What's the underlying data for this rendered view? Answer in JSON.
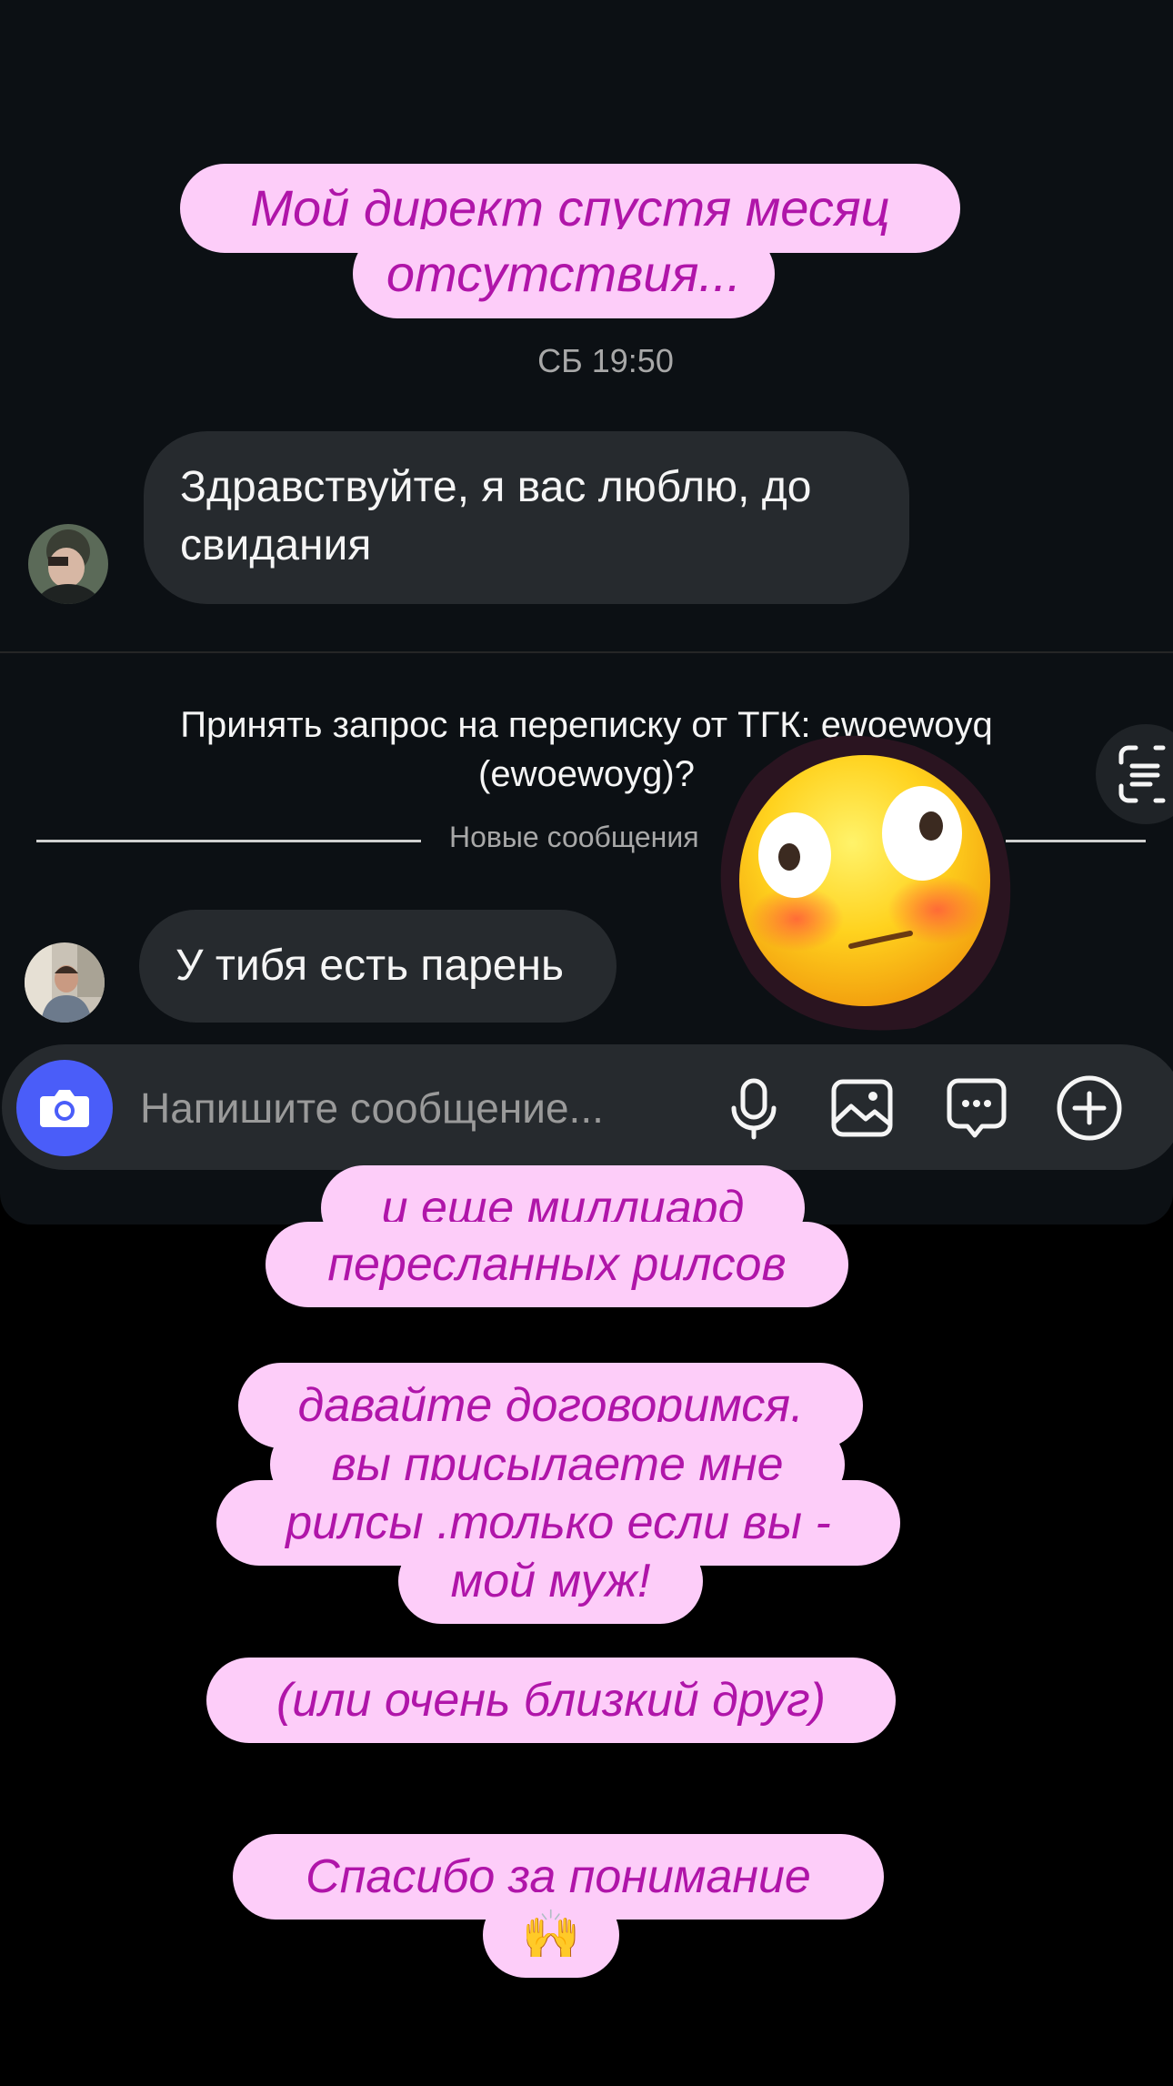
{
  "captions": {
    "top_line1": "Мой директ спустя месяц",
    "top_line2": "отсутствия...",
    "reels_line1": "и еще миллиард",
    "reels_line2": "пересланных рилсов",
    "deal_line1": "давайте договоримся,",
    "deal_line2": "вы присылаете мне",
    "deal_line3": "рилсы ,только если вы -",
    "deal_line4": "мой муж!",
    "friend": "(или очень близкий друг)",
    "thanks_line1": "Спасибо за понимание",
    "thanks_emoji": "🙌"
  },
  "thread": {
    "timestamp": "СБ 19:50",
    "message1": "Здравствуйте, я вас люблю, до свидания",
    "request_text": "Принять запрос на переписку от ТГК: ewoewoyq (ewoewoyg)?",
    "new_messages_label": "Новые сообщения",
    "message2": "У тибя есть парень"
  },
  "composer": {
    "placeholder": "Напишите сообщение..."
  },
  "colors": {
    "caption_bg": "#fdcdf9",
    "caption_text": "#b015a9",
    "bubble_bg": "#262a2e",
    "camera_button": "#4a5df9"
  },
  "icons": [
    "camera-icon",
    "microphone-icon",
    "image-icon",
    "sticker-icon",
    "plus-icon",
    "scan-icon"
  ]
}
